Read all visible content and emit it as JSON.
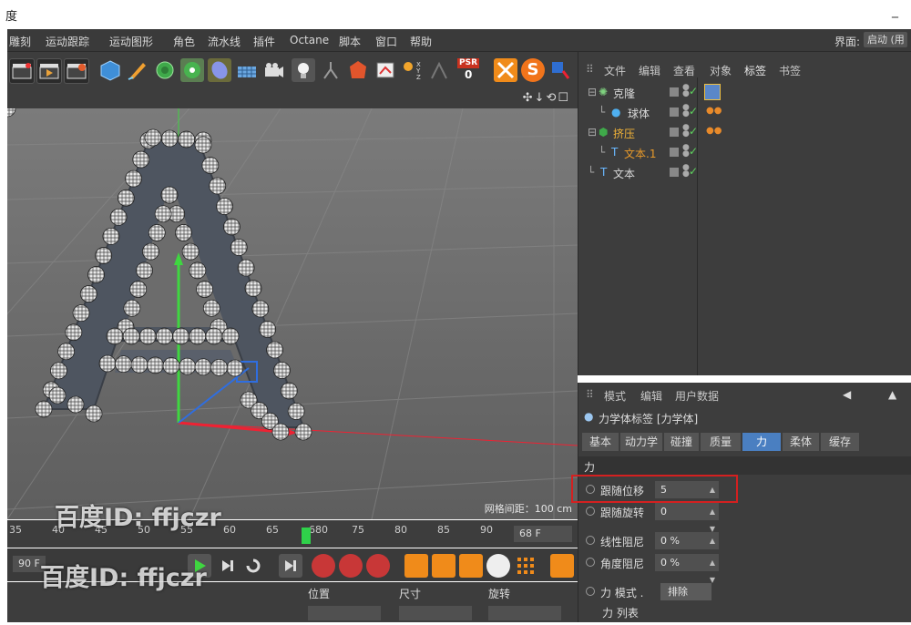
{
  "window": {
    "title": "度",
    "minimize_glyph": "_"
  },
  "menu": {
    "items": [
      "雕刻",
      "运动跟踪",
      "运动图形",
      "角色",
      "流水线",
      "插件",
      "Octane",
      "脚本",
      "窗口",
      "帮助"
    ],
    "interface_label": "界面:",
    "interface_value": "启动 (用"
  },
  "toolbar": {
    "psr_label": "PSR",
    "psr_value": "0",
    "snap_label": "S"
  },
  "viewport": {
    "grid_spacing": "网格间距：100 cm",
    "nav_controls": "✣↓⟲☐"
  },
  "timeline": {
    "ticks": [
      "35",
      "40",
      "45",
      "50",
      "55",
      "60",
      "65",
      "680",
      "75",
      "80",
      "85",
      "90"
    ],
    "current_frame_field": "68 F",
    "playhead_fraction": 0.55
  },
  "transport": {
    "start_field": "90 F"
  },
  "coords": {
    "position": "位置",
    "size": "尺寸",
    "rotation": "旋转"
  },
  "object_manager": {
    "tabs": [
      "文件",
      "编辑",
      "查看",
      "对象",
      "标签",
      "书签"
    ],
    "active_tab": "标签",
    "objects": [
      {
        "name": "克隆",
        "color": "#dadada"
      },
      {
        "name": "球体",
        "color": "#dadada"
      },
      {
        "name": "挤压",
        "color": "#f2b338"
      },
      {
        "name": "文本.1",
        "color": "#e89a2a"
      },
      {
        "name": "文本",
        "color": "#dadada"
      }
    ]
  },
  "attribute_manager": {
    "tabs": [
      "模式",
      "编辑",
      "用户数据"
    ],
    "tag_title": "力学体标签 [力学体]",
    "sub_tabs": [
      "基本",
      "动力学",
      "碰撞",
      "质量",
      "力",
      "柔体",
      "缓存"
    ],
    "selected_sub_tab": "力",
    "section_title": "力",
    "properties": [
      {
        "label": "跟随位移",
        "value": "5"
      },
      {
        "label": "跟随旋转",
        "value": "0"
      },
      {
        "label": "线性阻尼",
        "value": "0 %"
      },
      {
        "label": "角度阻尼",
        "value": "0 %"
      }
    ],
    "force_mode_label": "力 模式 .",
    "force_mode_value": "排除",
    "force_list_label": "力 列表"
  },
  "watermark": {
    "text": "百度ID: ffjczr"
  },
  "colors": {
    "panel": "#3d3d3d",
    "viewport": "#6c6c6c",
    "accent": "#4a7fc1",
    "highlight": "#d42020"
  }
}
